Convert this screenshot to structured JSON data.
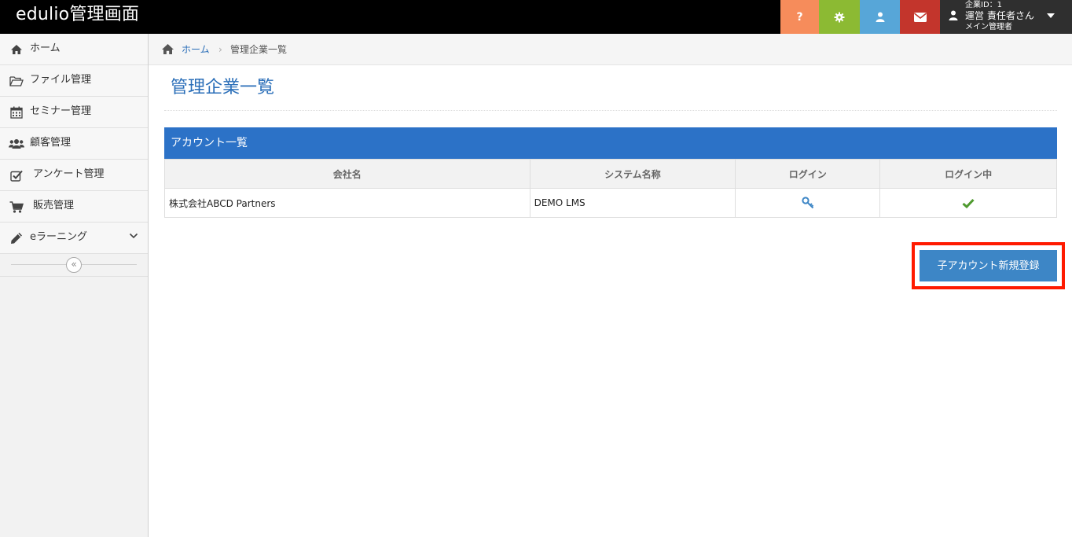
{
  "navbar": {
    "brand": "edulio管理画面",
    "help_label": "?",
    "user": {
      "company_id": "企業ID：1",
      "name": "運営 責任者さん",
      "role": "メイン管理者"
    },
    "colors": {
      "help": "#f68c5b",
      "settings": "#8cba33",
      "user": "#57a6d8",
      "mail": "#c3352c"
    }
  },
  "sidebar": {
    "items": [
      {
        "label": "ホーム",
        "icon": "home-icon"
      },
      {
        "label": "ファイル管理",
        "icon": "folder-icon"
      },
      {
        "label": "セミナー管理",
        "icon": "calendar-icon"
      },
      {
        "label": "顧客管理",
        "icon": "users-icon"
      },
      {
        "label": "アンケート管理",
        "icon": "checkbox-icon"
      },
      {
        "label": "販売管理",
        "icon": "cart-icon"
      },
      {
        "label": "eラーニング",
        "icon": "pencil-icon"
      }
    ],
    "collapse_label": "«"
  },
  "breadcrumb": {
    "home": "ホーム",
    "separator": "›",
    "current": "管理企業一覧"
  },
  "page": {
    "title": "管理企業一覧"
  },
  "table": {
    "title": "アカウント一覧",
    "columns": [
      "会社名",
      "システム名称",
      "ログイン",
      "ログイン中"
    ],
    "rows": [
      {
        "company": "株式会社ABCD Partners",
        "system": "DEMO LMS",
        "login": "key-icon",
        "logged_in": "check-icon"
      }
    ]
  },
  "actions": {
    "new_child_account": "子アカウント新規登録"
  }
}
